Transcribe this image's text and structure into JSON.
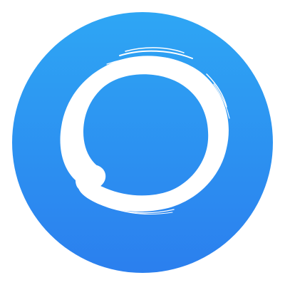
{
  "app_icon": {
    "icon_name": "ring-icon",
    "colors": {
      "page_background": "#ffffff",
      "badge_gradient_top": "#2ea6f4",
      "badge_gradient_bottom": "#2b7fee",
      "stroke": "#ffffff"
    }
  }
}
